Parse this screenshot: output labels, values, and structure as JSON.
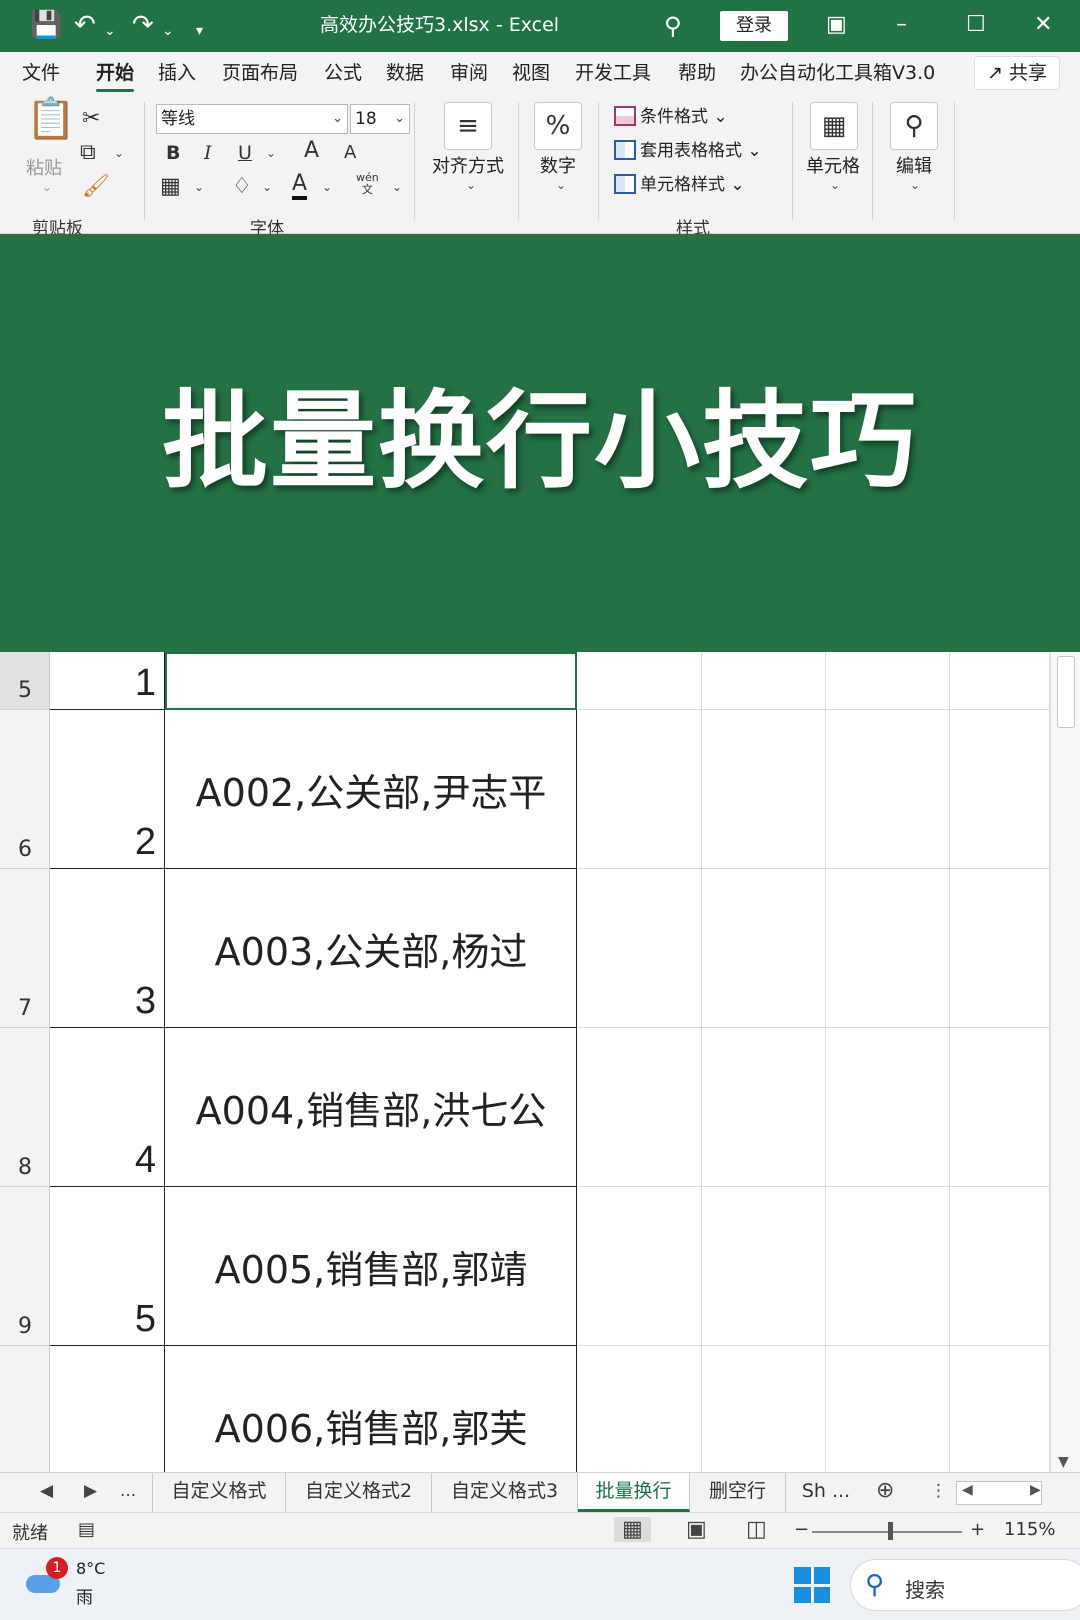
{
  "titlebar": {
    "save_icon": "save-icon",
    "undo_icon": "undo-icon",
    "redo_icon": "redo-icon",
    "title": "高效办公技巧3.xlsx  -  Excel",
    "login": "登录"
  },
  "menu": {
    "tabs": [
      "文件",
      "开始",
      "插入",
      "页面布局",
      "公式",
      "数据",
      "审阅",
      "视图",
      "开发工具",
      "帮助",
      "办公自动化工具箱V3.0"
    ],
    "active": "开始",
    "share": "共享"
  },
  "ribbon": {
    "paste": "粘贴",
    "clipboard_group": "剪贴板",
    "font_name": "等线",
    "font_size": "18",
    "font_group": "字体",
    "bold": "B",
    "italic": "I",
    "underline": "U",
    "grow": "A",
    "shrink": "A",
    "font_color": "A",
    "wen": "wén",
    "wen_char": "文",
    "align": "对齐方式",
    "number": "数字",
    "percent": "%",
    "conditional": "条件格式",
    "table_format": "套用表格格式",
    "cell_styles": "单元格样式",
    "styles_group": "样式",
    "cells": "单元格",
    "editing": "编辑"
  },
  "banner": {
    "headline": "批量换行小技巧"
  },
  "grid": {
    "rows": [
      {
        "row": "5",
        "num": "1",
        "content": ""
      },
      {
        "row": "6",
        "num": "2",
        "content": "A002,公关部,尹志平"
      },
      {
        "row": "7",
        "num": "3",
        "content": "A003,公关部,杨过"
      },
      {
        "row": "8",
        "num": "4",
        "content": "A004,销售部,洪七公"
      },
      {
        "row": "9",
        "num": "5",
        "content": "A005,销售部,郭靖"
      },
      {
        "row": "",
        "num": "",
        "content": "A006,销售部,郭芙"
      }
    ]
  },
  "sheets": {
    "tabs": [
      "自定义格式",
      "自定义格式2",
      "自定义格式3",
      "批量换行",
      "删空行",
      "Sh ..."
    ],
    "active": "批量换行",
    "more": "..."
  },
  "status": {
    "ready": "就绪",
    "zoom": "115%",
    "minus": "−",
    "plus": "+"
  },
  "taskbar": {
    "badge": "1",
    "temperature": "8°C",
    "condition": "雨",
    "search": "搜索"
  },
  "colors": {
    "accent": "#217346",
    "banner": "#237145"
  }
}
